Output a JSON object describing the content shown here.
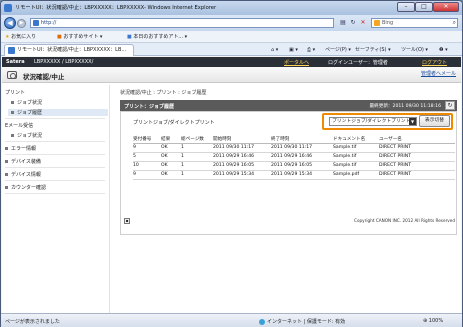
{
  "window": {
    "title": "リモートUI：状況確認/中止：LBPXXXXX：LBPXXXXX- Windows Internet Explorer"
  },
  "address_bar": {
    "url": "http://",
    "search_placeholder": "Bing"
  },
  "favorites": {
    "label": "お気に入り",
    "items": [
      "おすすめサイト ▾",
      "本日のおすすめアト... ▾"
    ]
  },
  "tab": {
    "title": "リモートUI：状況確認/中止：LBPXXXXX：LB..."
  },
  "toolbar": {
    "page": "ページ(P) ▾",
    "safety": "セーフティ(S) ▾",
    "tools": "ツール(O) ▾",
    "help": "❷ ▾"
  },
  "brandbar": {
    "brand": "Satera",
    "model": "LBPXXXXX / LBPXXXXX/",
    "portal": "ポータルへ",
    "login_user": "ログインユーザー：管理者",
    "logout": "ログアウト"
  },
  "header": {
    "title": "状況確認/中止",
    "manager": "管理者へメール"
  },
  "sidebar": {
    "print_heading": "プリント",
    "print_items": [
      "ジョブ状況",
      "ジョブ履歴"
    ],
    "email_heading": "Eメール受信",
    "other_items": [
      "エラー情報",
      "デバイス装備",
      "デバイス情報",
      "カウンター確認"
    ],
    "email_items": [
      "ジョブ状況"
    ]
  },
  "content": {
    "breadcrumb": "状況確認/中止 : プリント : ジョブ履歴",
    "section_title": "プリント：ジョブ履歴",
    "last_update": "最終更新：2011 09/30 11:18:16",
    "subheading": "プリントジョブ/ダイレクトプリント",
    "select_value": "プリントジョブ/ダイレクトプリント",
    "display_button": "表示切替",
    "table": {
      "headers": [
        "受付番号",
        "結果",
        "総ページ数",
        "開始時刻",
        "終了時刻",
        "ドキュメント名",
        "ユーザー名"
      ],
      "rows": [
        [
          "9",
          "OK",
          "1",
          "2011 09/30 11:17",
          "2011 09/30 11:17",
          "Sample.tif",
          "DIRECT PRINT"
        ],
        [
          "5",
          "OK",
          "1",
          "2011 09/29 16:46",
          "2011 09/29 16:46",
          "Sample.tif",
          "DIRECT PRINT"
        ],
        [
          "10",
          "OK",
          "1",
          "2011 09/29 16:05",
          "2011 09/29 16:05",
          "Sample.tif",
          "DIRECT PRINT"
        ],
        [
          "9",
          "OK",
          "1",
          "2011 09/29 15:34",
          "2011 09/29 15:34",
          "Sample.pdf",
          "DIRECT PRINT"
        ]
      ]
    },
    "copyright": "Copyright CANON INC. 2012 All Rights Reserved"
  },
  "statusbar": {
    "left": "ページが表示されました",
    "zone": "インターネット | 保護モード: 有効",
    "zoom": "100%"
  }
}
